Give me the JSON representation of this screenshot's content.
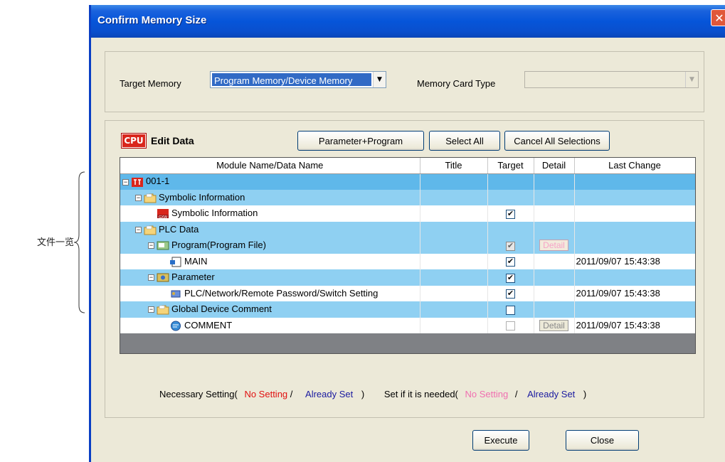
{
  "outside_label": "文件一览",
  "window": {
    "title": "Confirm Memory Size",
    "close_glyph": "✕"
  },
  "target_group": {
    "target_memory_label": "Target Memory",
    "target_memory_value": "Program Memory/Device Memory",
    "memory_card_type_label": "Memory Card Type",
    "memory_card_type_value": ""
  },
  "edit_data": {
    "icon_text": "CPU",
    "title": "Edit Data",
    "buttons": {
      "parameter_program": "Parameter+Program",
      "select_all": "Select All",
      "cancel_all": "Cancel All Selections"
    },
    "columns": [
      "Module Name/Data Name",
      "Title",
      "Target",
      "Detail",
      "Last Change"
    ],
    "rows": [
      {
        "indent": 0,
        "expander": "−",
        "icon": "cpu-icon",
        "name": "001-1",
        "title": "",
        "target": "none",
        "detail": "",
        "last_change": "",
        "style": "sel"
      },
      {
        "indent": 1,
        "expander": "−",
        "icon": "folder-icon",
        "name": "Symbolic Information",
        "title": "",
        "target": "none",
        "detail": "",
        "last_change": "",
        "style": "blue"
      },
      {
        "indent": 2,
        "expander": "",
        "icon": "symbolic-info-icon",
        "name": "Symbolic Information",
        "title": "",
        "target": "checked",
        "detail": "",
        "last_change": "",
        "style": "white"
      },
      {
        "indent": 1,
        "expander": "−",
        "icon": "folder-icon",
        "name": "PLC Data",
        "title": "",
        "target": "none",
        "detail": "",
        "last_change": "",
        "style": "blue"
      },
      {
        "indent": 2,
        "expander": "−",
        "icon": "program-folder-icon",
        "name": "Program(Program File)",
        "title": "",
        "target": "gray",
        "detail": "Detail",
        "detail_style": "pink",
        "last_change": "",
        "style": "blue"
      },
      {
        "indent": 3,
        "expander": "",
        "icon": "program-file-icon",
        "name": "MAIN",
        "title": "",
        "target": "checked",
        "detail": "",
        "last_change": "2011/09/07 15:43:38",
        "style": "white"
      },
      {
        "indent": 2,
        "expander": "−",
        "icon": "parameter-icon",
        "name": "Parameter",
        "title": "",
        "target": "checked",
        "detail": "",
        "last_change": "",
        "style": "blue"
      },
      {
        "indent": 3,
        "expander": "",
        "icon": "network-param-icon",
        "name": "PLC/Network/Remote Password/Switch Setting",
        "title": "",
        "target": "checked",
        "detail": "",
        "last_change": "2011/09/07 15:43:38",
        "style": "white"
      },
      {
        "indent": 2,
        "expander": "−",
        "icon": "folder-icon",
        "name": "Global Device Comment",
        "title": "",
        "target": "unchecked",
        "detail": "",
        "last_change": "",
        "style": "blue"
      },
      {
        "indent": 3,
        "expander": "",
        "icon": "comment-icon",
        "name": "COMMENT",
        "title": "",
        "target": "unchecked-dis",
        "detail": "Detail",
        "detail_style": "gray",
        "last_change": "2011/09/07 15:43:38",
        "style": "white"
      }
    ]
  },
  "legend": {
    "necessary_prefix": "Necessary Setting(",
    "no_setting": "No Setting",
    "slash": "/",
    "already_set": "Already Set",
    "close_paren": ")",
    "if_needed_prefix": "Set if it is needed(",
    "no_setting2": "No Setting",
    "slash2": "/",
    "already_set2": "Already Set",
    "close_paren2": ")"
  },
  "footer": {
    "execute": "Execute",
    "close": "Close"
  },
  "colors": {
    "title_bar": "#0655d9",
    "row_selected": "#5fb8ea",
    "row_group": "#8fd0f2",
    "no_setting_red": "#e01010",
    "already_set_blue": "#1a1aa0",
    "no_setting_pink": "#f06fb0"
  }
}
